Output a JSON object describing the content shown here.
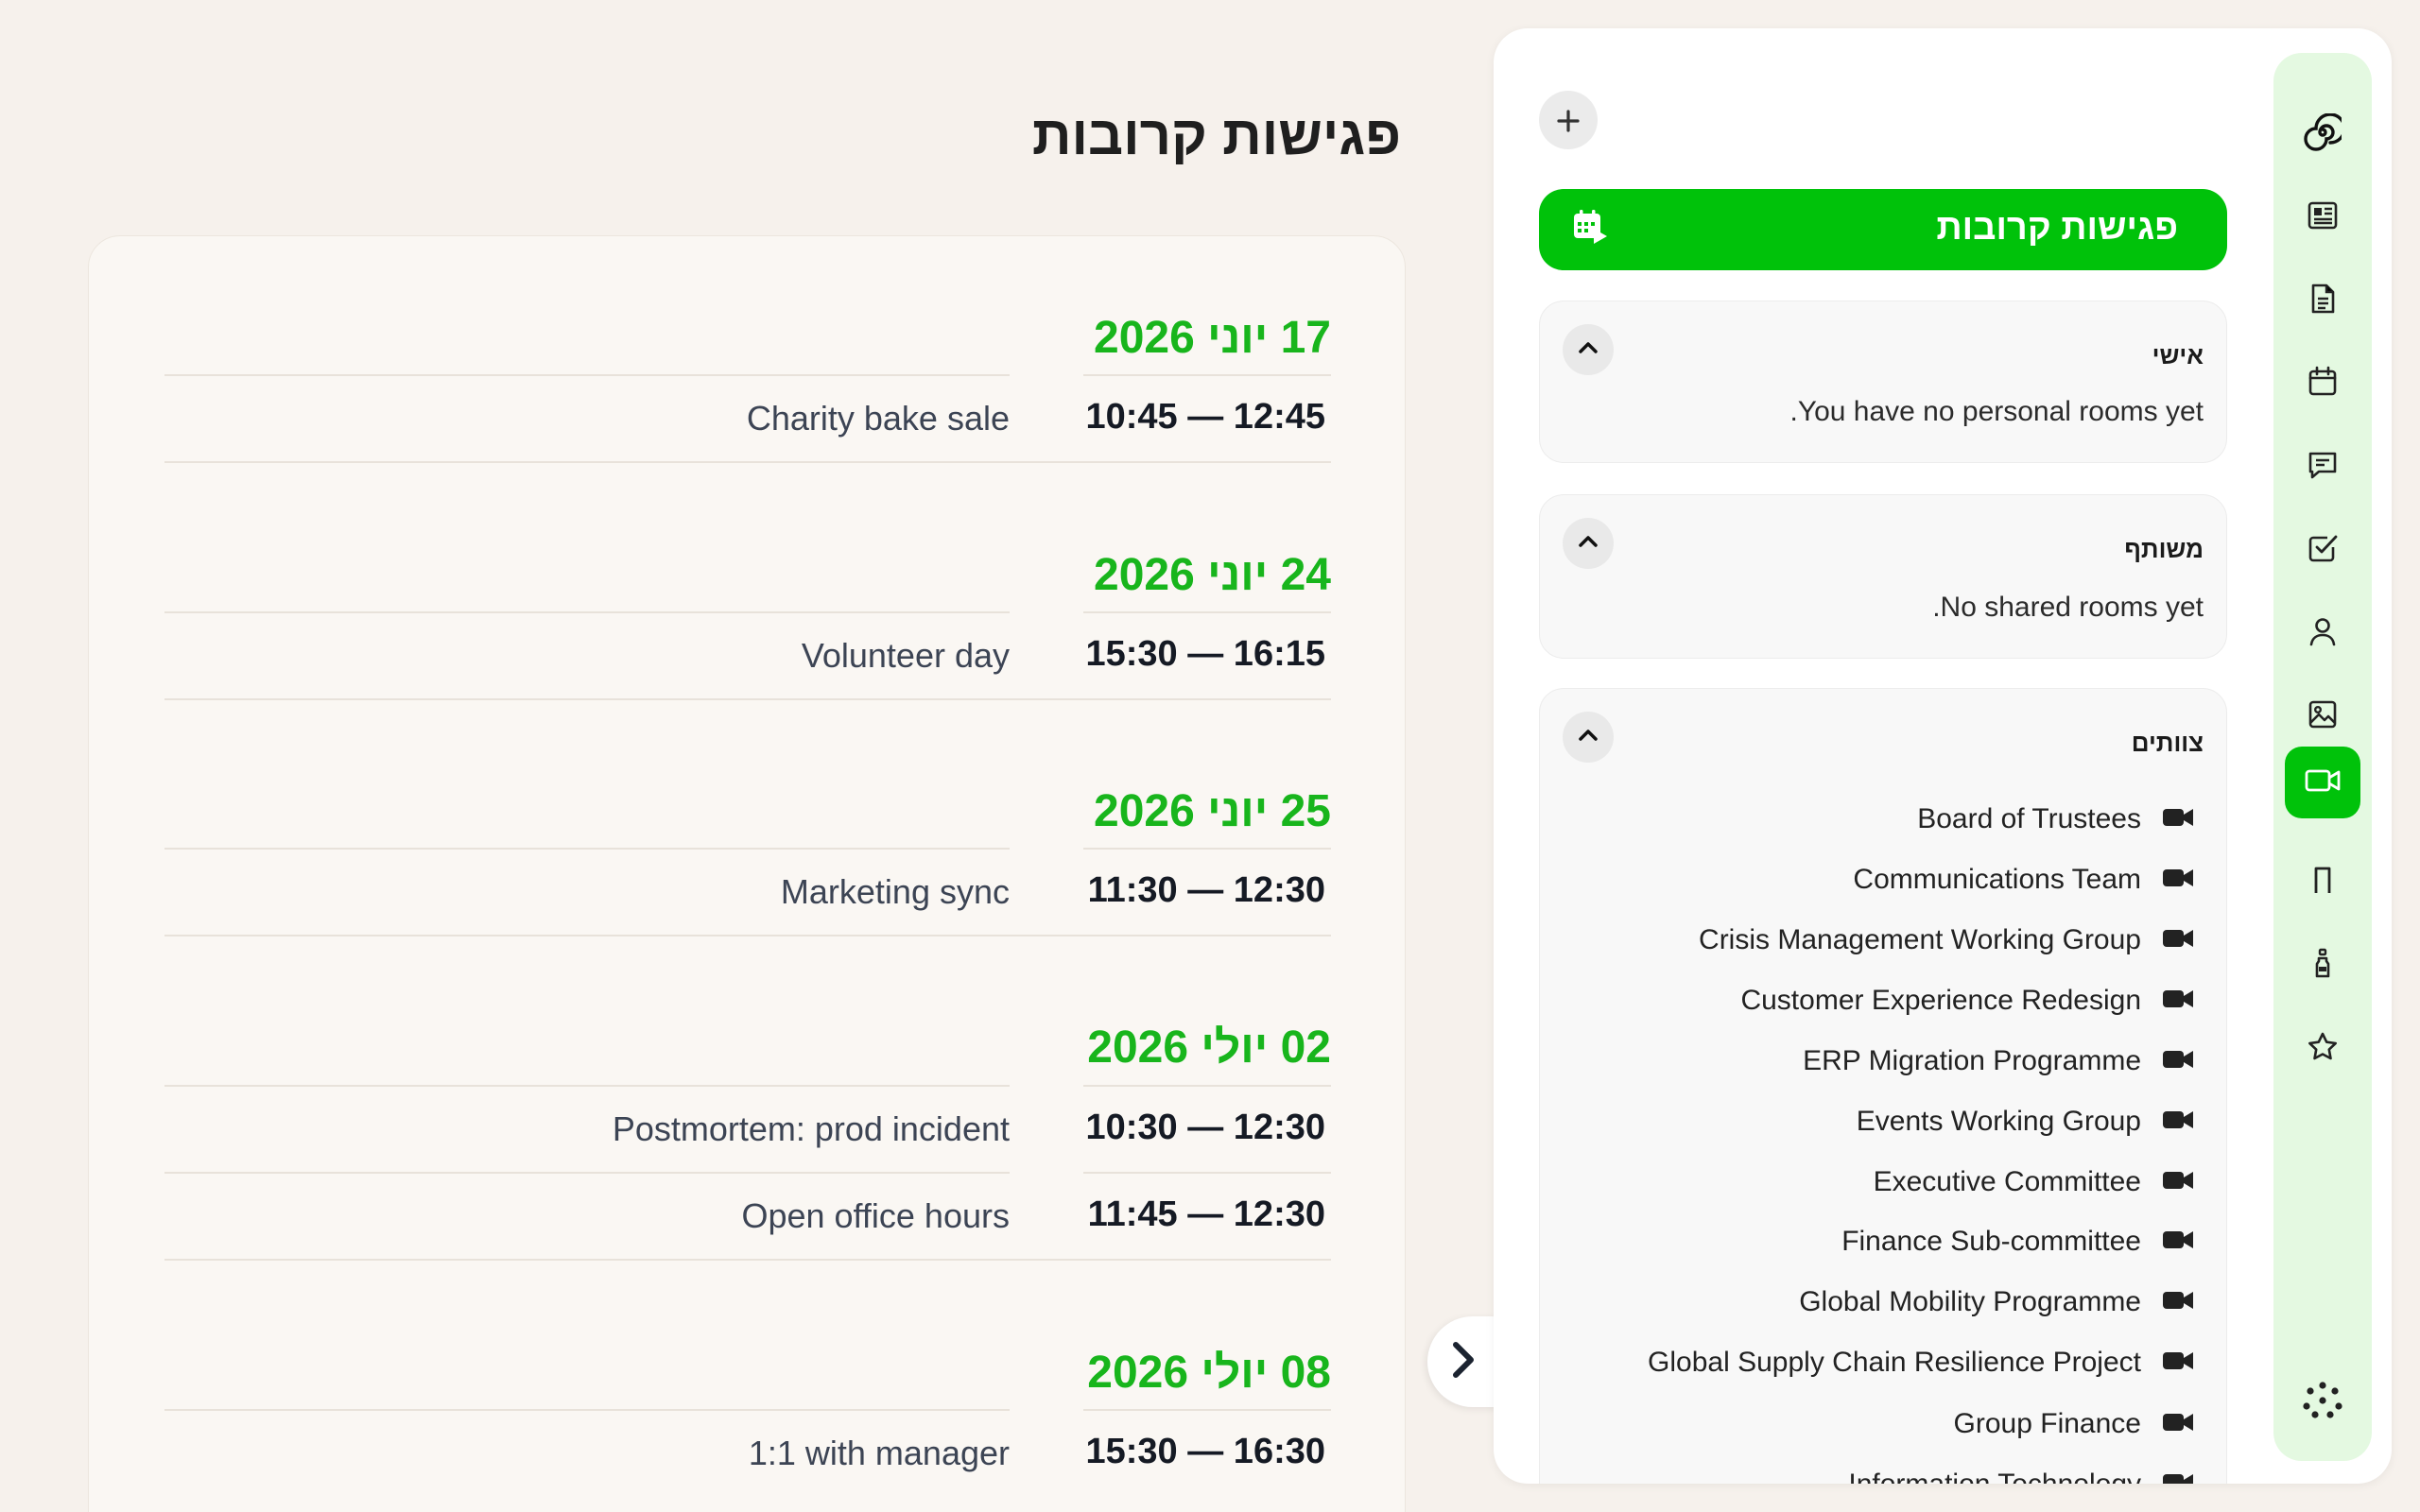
{
  "page": {
    "title": "פגישות קרובות"
  },
  "meeting_days": [
    {
      "date": "17 יוני 2026",
      "meetings": [
        {
          "title": "Charity bake sale",
          "time": "10:45 — 12:45"
        }
      ]
    },
    {
      "date": "24 יוני 2026",
      "meetings": [
        {
          "title": "Volunteer day",
          "time": "15:30 — 16:15"
        }
      ]
    },
    {
      "date": "25 יוני 2026",
      "meetings": [
        {
          "title": "Marketing sync",
          "time": "11:30 — 12:30"
        }
      ]
    },
    {
      "date": "02 יולי 2026",
      "meetings": [
        {
          "title": "Postmortem: prod incident",
          "time": "10:30 — 12:30"
        },
        {
          "title": "Open office hours",
          "time": "11:45 — 12:30"
        }
      ]
    },
    {
      "date": "08 יולי 2026",
      "meetings": [
        {
          "title": "1:1 with manager",
          "time": "15:30 — 16:30"
        }
      ]
    }
  ],
  "sidebar": {
    "upcoming_label": "פגישות קרובות",
    "personal": {
      "title": "אישי",
      "empty": "You have no personal rooms yet."
    },
    "shared": {
      "title": "משותף",
      "empty": "No shared rooms yet."
    },
    "teams": {
      "title": "צוותים",
      "items": [
        "Board of Trustees",
        "Communications Team",
        "Crisis Management Working Group",
        "Customer Experience Redesign",
        "ERP Migration Programme",
        "Events Working Group",
        "Executive Committee",
        "Finance Sub-committee",
        "Global Mobility Programme",
        "Global Supply Chain Resilience Project",
        "Group Finance",
        "Information Technology"
      ]
    }
  },
  "rail_icons": [
    "spiral-logo-icon",
    "newspaper-icon",
    "document-icon",
    "calendar-icon",
    "chat-icon",
    "checkbox-icon",
    "user-icon",
    "image-icon",
    "video-icon",
    "bookmark-icon",
    "bottle-icon",
    "star-icon"
  ],
  "colors": {
    "accent": "#00c20a",
    "date_green": "#18b51c",
    "background": "#f6f1ec",
    "rail": "#e4f9e1"
  }
}
